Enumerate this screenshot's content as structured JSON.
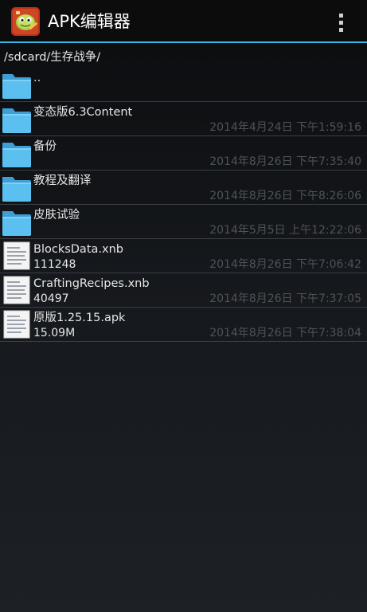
{
  "app": {
    "title": "APK编辑器",
    "icon": "apk-editor-app-icon",
    "accent_color": "#33b5e5"
  },
  "path": "/sdcard/生存战争/",
  "files": [
    {
      "name": "..",
      "type": "folder",
      "icon": "folder-icon",
      "size": "",
      "date": ""
    },
    {
      "name": "变态版6.3Content",
      "type": "folder",
      "icon": "folder-icon",
      "size": "",
      "date": "2014年4月24日 下午1:59:16"
    },
    {
      "name": "备份",
      "type": "folder",
      "icon": "folder-icon",
      "size": "",
      "date": "2014年8月26日 下午7:35:40"
    },
    {
      "name": "教程及翻译",
      "type": "folder",
      "icon": "folder-icon",
      "size": "",
      "date": "2014年8月26日 下午8:26:06"
    },
    {
      "name": "皮肤试验",
      "type": "folder",
      "icon": "folder-icon",
      "size": "",
      "date": "2014年5月5日 上午12:22:06"
    },
    {
      "name": "BlocksData.xnb",
      "type": "file",
      "icon": "document-icon",
      "size": "111248",
      "date": "2014年8月26日 下午7:06:42"
    },
    {
      "name": "CraftingRecipes.xnb",
      "type": "file",
      "icon": "document-icon",
      "size": "40497",
      "date": "2014年8月26日 下午7:37:05"
    },
    {
      "name": "原版1.25.15.apk",
      "type": "file",
      "icon": "document-icon",
      "size": "15.09M",
      "date": "2014年8月26日 下午7:38:04"
    }
  ]
}
